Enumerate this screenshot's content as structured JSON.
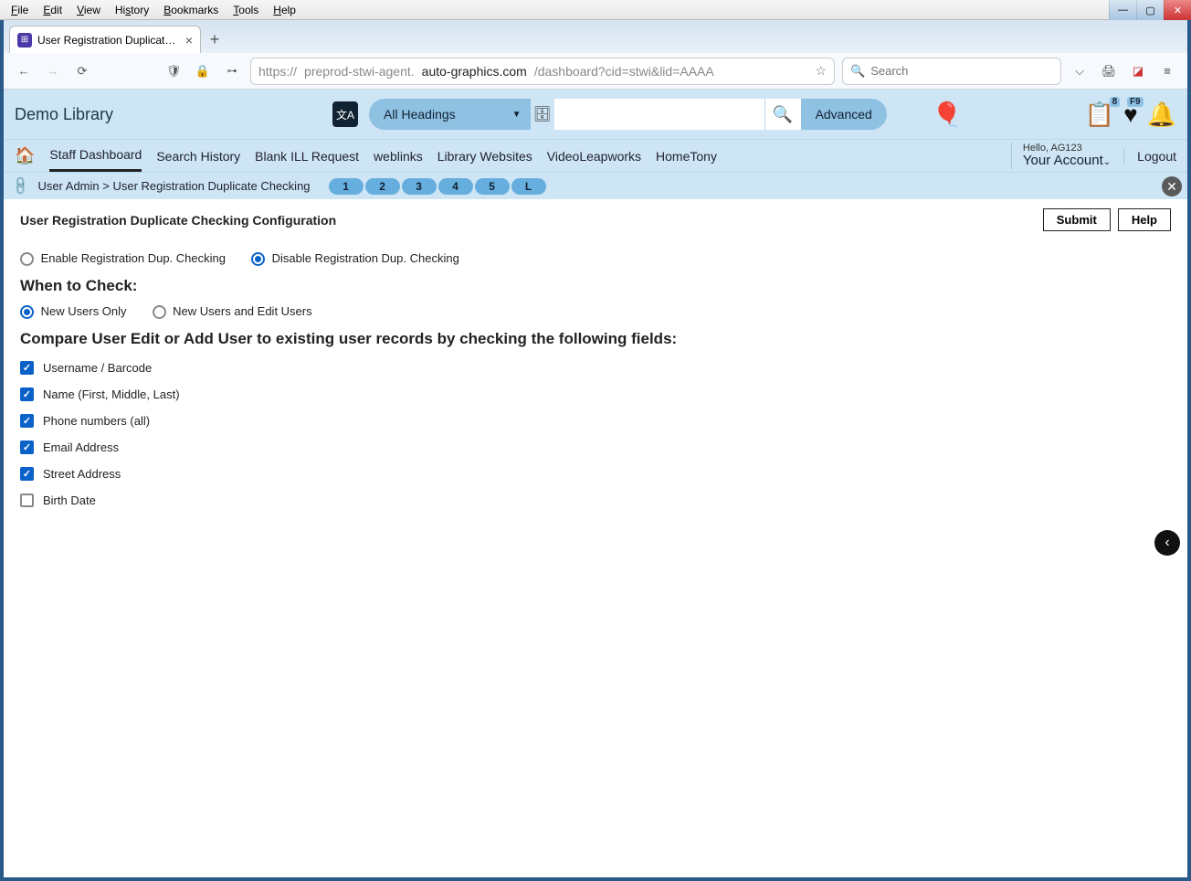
{
  "os_menu": [
    "File",
    "Edit",
    "View",
    "History",
    "Bookmarks",
    "Tools",
    "Help"
  ],
  "tab": {
    "title": "User Registration Duplicate Che"
  },
  "url": {
    "proto": "https://",
    "sub": "preprod-stwi-agent.",
    "domain": "auto-graphics.com",
    "path": "/dashboard?cid=stwi&lid=AAAA"
  },
  "browser_search_placeholder": "Search",
  "app": {
    "library_name": "Demo Library",
    "headings_label": "All Headings",
    "advanced_label": "Advanced",
    "badge_list": "8",
    "badge_fav": "F9",
    "greeting": "Hello, AG123",
    "account_label": "Your Account",
    "logout_label": "Logout"
  },
  "nav": {
    "items": [
      "Staff Dashboard",
      "Search History",
      "Blank ILL Request",
      "weblinks",
      "Library Websites",
      "VideoLeapworks",
      "HomeTony"
    ],
    "active_index": 0
  },
  "crumb": {
    "parent": "User Admin",
    "sep": ">",
    "current": "User Registration Duplicate Checking",
    "pills": [
      "1",
      "2",
      "3",
      "4",
      "5",
      "L"
    ]
  },
  "cfg": {
    "title": "User Registration Duplicate Checking Configuration",
    "submit": "Submit",
    "help": "Help",
    "enable_label": "Enable Registration Dup. Checking",
    "disable_label": "Disable Registration Dup. Checking",
    "mode_selected": "disable",
    "when_heading": "When to Check:",
    "when_new": "New Users Only",
    "when_both": "New Users and Edit Users",
    "when_selected": "new",
    "compare_heading": "Compare User Edit or Add User to existing user records by checking the following fields:",
    "fields": [
      {
        "label": "Username / Barcode",
        "checked": true
      },
      {
        "label": "Name (First, Middle, Last)",
        "checked": true
      },
      {
        "label": "Phone numbers (all)",
        "checked": true
      },
      {
        "label": "Email Address",
        "checked": true
      },
      {
        "label": "Street Address",
        "checked": true
      },
      {
        "label": "Birth Date",
        "checked": false
      }
    ]
  }
}
